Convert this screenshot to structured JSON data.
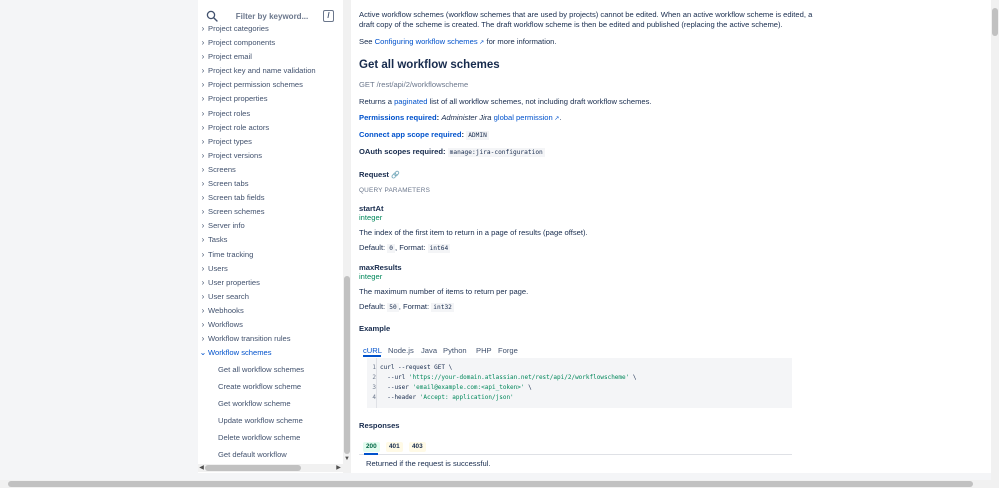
{
  "sidebar": {
    "search_placeholder": "Filter by keyword...",
    "search_shortcut": "/",
    "items": [
      {
        "label": "Project categories"
      },
      {
        "label": "Project components"
      },
      {
        "label": "Project email"
      },
      {
        "label": "Project key and name validation"
      },
      {
        "label": "Project permission schemes"
      },
      {
        "label": "Project properties"
      },
      {
        "label": "Project roles"
      },
      {
        "label": "Project role actors"
      },
      {
        "label": "Project types"
      },
      {
        "label": "Project versions"
      },
      {
        "label": "Screens"
      },
      {
        "label": "Screen tabs"
      },
      {
        "label": "Screen tab fields"
      },
      {
        "label": "Screen schemes"
      },
      {
        "label": "Server info"
      },
      {
        "label": "Tasks"
      },
      {
        "label": "Time tracking"
      },
      {
        "label": "Users"
      },
      {
        "label": "User properties"
      },
      {
        "label": "User search"
      },
      {
        "label": "Webhooks"
      },
      {
        "label": "Workflows"
      },
      {
        "label": "Workflow transition rules"
      },
      {
        "label": "Workflow schemes"
      }
    ],
    "sub_items": [
      {
        "label": "Get all workflow schemes"
      },
      {
        "label": "Create workflow scheme"
      },
      {
        "label": "Get workflow scheme"
      },
      {
        "label": "Update workflow scheme"
      },
      {
        "label": "Delete workflow scheme"
      },
      {
        "label": "Get default workflow"
      }
    ]
  },
  "main": {
    "intro_line1": "Active workflow schemes (workflow schemes that are used by projects) cannot be edited. When an active workflow scheme is edited, a",
    "intro_line2": "draft copy of the scheme is created. The draft workflow scheme is then be edited and published (replacing the active scheme).",
    "see_prefix": "See",
    "see_link": "Configuring workflow schemes",
    "see_suffix": "for more information.",
    "heading": "Get all workflow schemes",
    "endpoint": "GET /rest/api/2/workflowscheme",
    "returns_prefix": "Returns a",
    "returns_link": "paginated",
    "returns_suffix": "list of all workflow schemes, not including draft workflow schemes.",
    "permissions_label": "Permissions required",
    "permissions_text": "Administer Jira",
    "permissions_link": "global permission",
    "connect_label": "Connect app scope required",
    "connect_value": "ADMIN",
    "oauth_label": "OAuth scopes required",
    "oauth_value": "manage:jira-configuration",
    "request_label": "Request",
    "query_params_label": "QUERY PARAMETERS",
    "params": [
      {
        "name": "startAt",
        "type": "integer",
        "description": "The index of the first item to return in a page of results (page offset).",
        "default_label": "Default:",
        "default_value": "0",
        "format_label": "Format:",
        "format_value": "int64"
      },
      {
        "name": "maxResults",
        "type": "integer",
        "description": "The maximum number of items to return per page.",
        "default_label": "Default:",
        "default_value": "50",
        "format_label": "Format:",
        "format_value": "int32"
      }
    ],
    "example_label": "Example",
    "tabs": [
      "cURL",
      "Node.js",
      "Java",
      "Python",
      "PHP",
      "Forge"
    ],
    "code_lines": [
      {
        "no": "1",
        "text": "curl --request GET \\"
      },
      {
        "no": "2",
        "prefix": "  --url ",
        "string": "'https://your-domain.atlassian.net/rest/api/2/workflowscheme'",
        "suffix": " \\"
      },
      {
        "no": "3",
        "prefix": "  --user ",
        "string": "'email@example.com:<api_token>'",
        "suffix": " \\"
      },
      {
        "no": "4",
        "prefix": "  --header ",
        "string": "'Accept: application/json'",
        "suffix": ""
      }
    ],
    "responses_label": "Responses",
    "response_codes": [
      "200",
      "401",
      "403"
    ],
    "response_description": "Returned if the request is successful."
  },
  "colors": {
    "link": "#0052cc",
    "text": "#172b4d",
    "type": "#00875a"
  }
}
